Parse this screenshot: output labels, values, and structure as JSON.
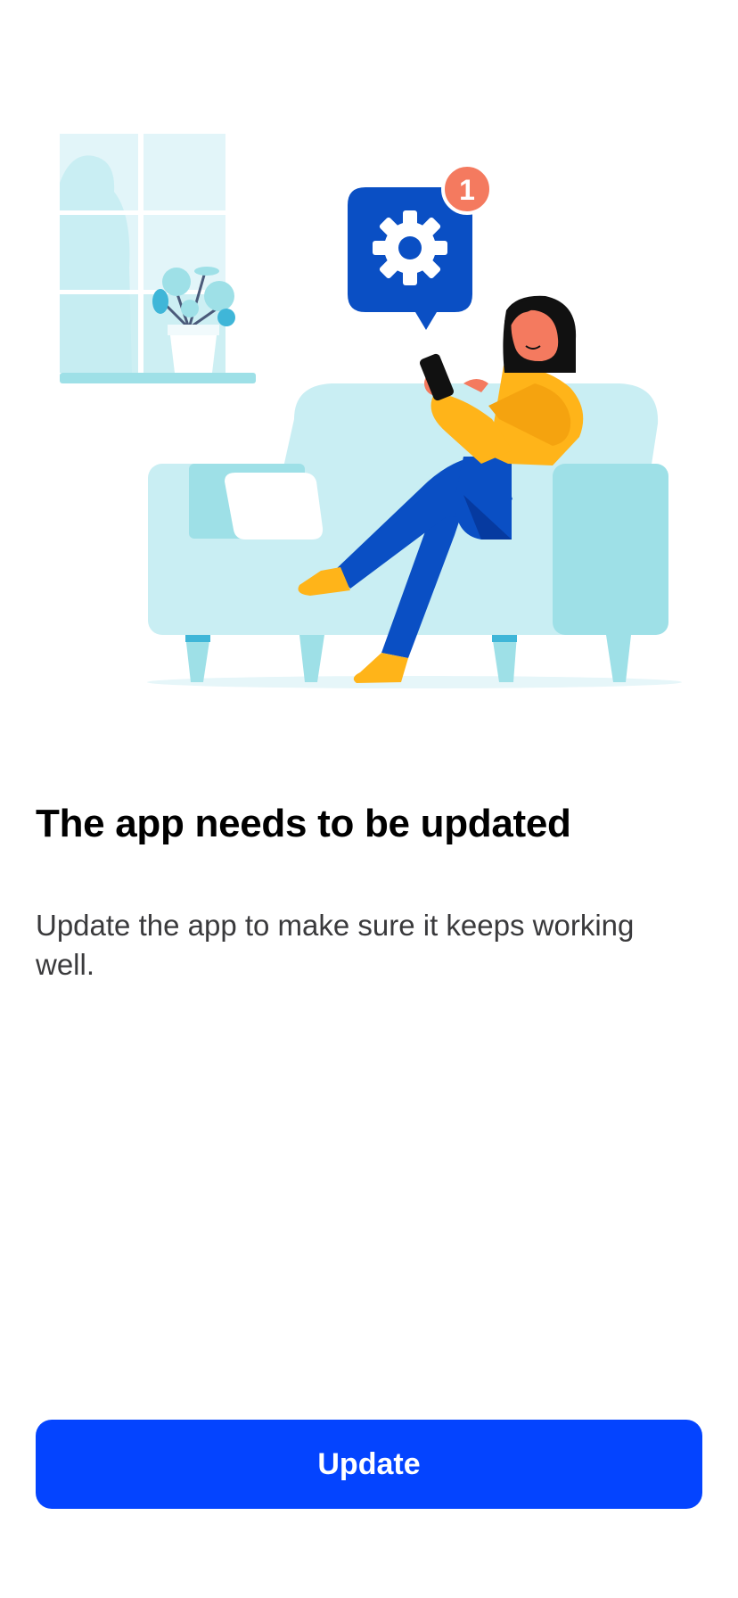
{
  "screen": {
    "title": "The app needs to be updated",
    "description": "Update the app to make sure it keeps working well.",
    "update_button_label": "Update"
  },
  "illustration": {
    "notification_badge_count": "1",
    "icons": [
      "settings-gear-icon",
      "notification-badge-icon",
      "phone-icon"
    ]
  },
  "colors": {
    "primary_button": "#0444ff",
    "button_text": "#ffffff",
    "title_text": "#000000",
    "body_text": "#3a3a3c",
    "brand_blue": "#0a4fc4",
    "badge_red": "#f47a5f",
    "sofa_light": "#c8ecf1",
    "sofa_accent": "#9be0e6",
    "sweater_yellow": "#ffb419"
  }
}
